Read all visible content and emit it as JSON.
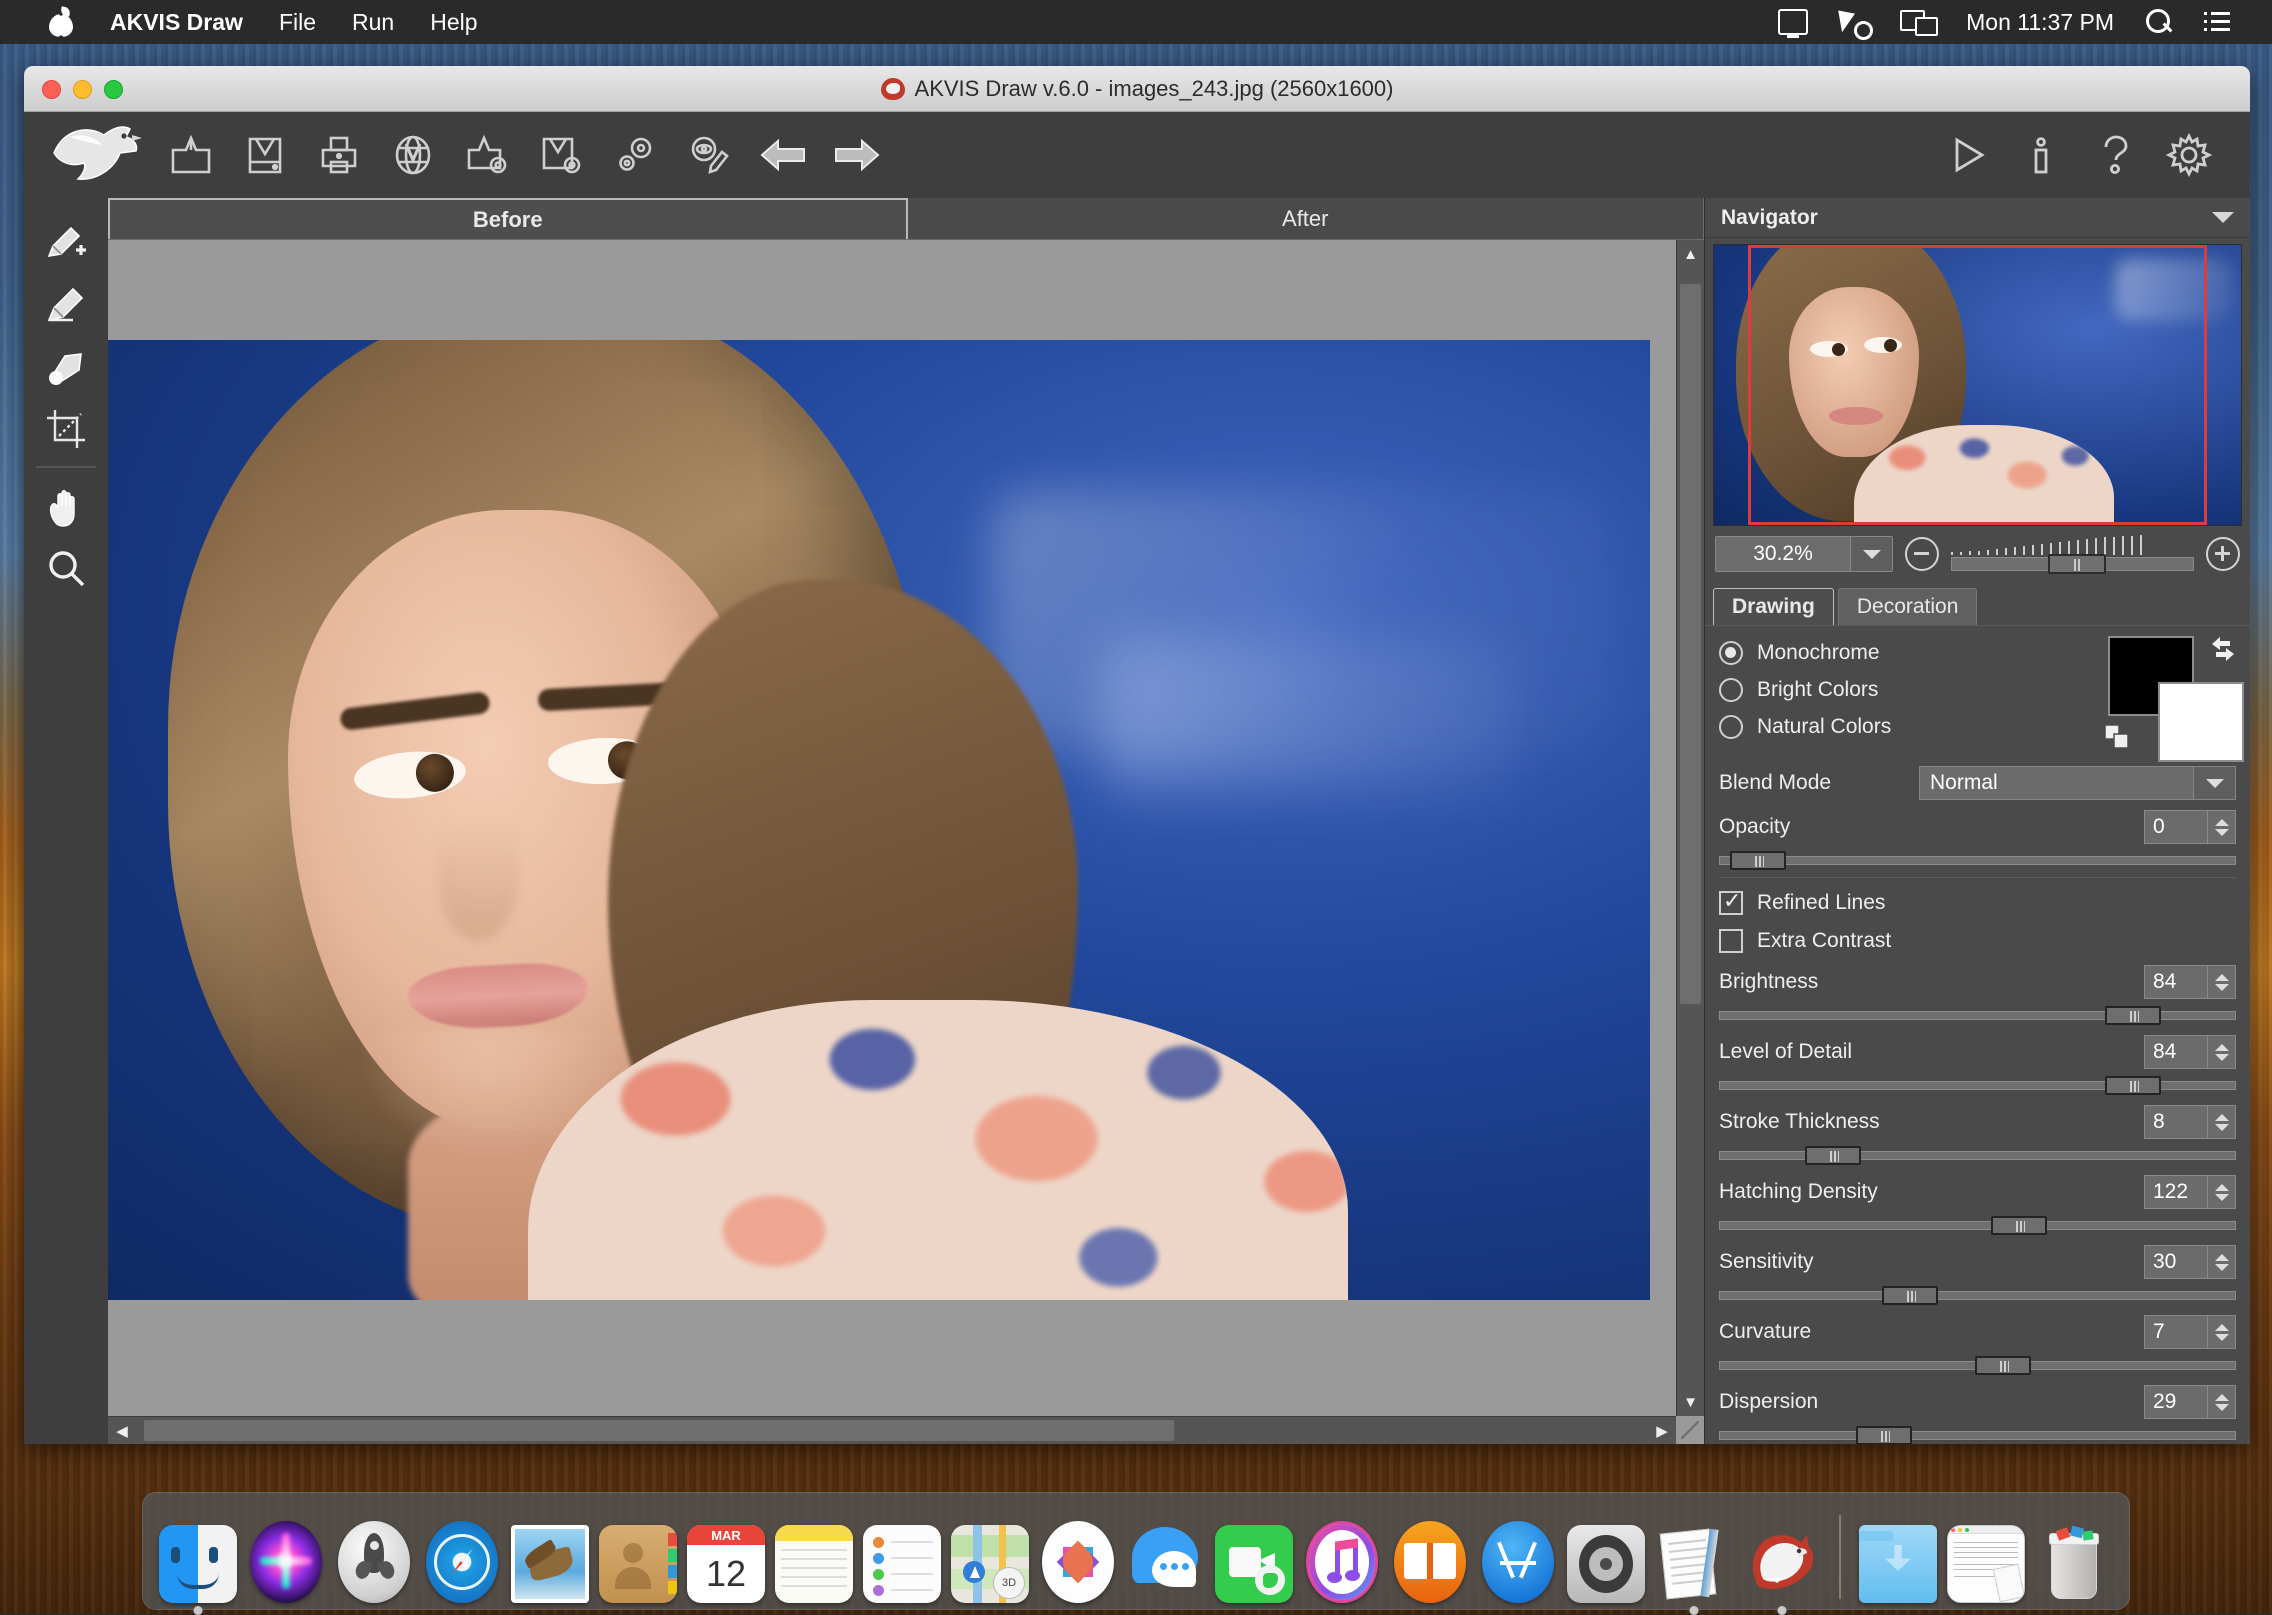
{
  "menubar": {
    "apple_icon": "apple-logo",
    "items": [
      "AKVIS Draw",
      "File",
      "Run",
      "Help"
    ],
    "status_icons": [
      "time-machine-icon",
      "siri-icon",
      "display-mirroring-icon"
    ],
    "clock": "Mon 11:37 PM",
    "search_icon": "search-icon",
    "notification_icon": "notification-center-icon"
  },
  "window": {
    "title": "AKVIS Draw v.6.0 - images_243.jpg (2560x1600)",
    "app_icon": "akvis-bird-icon",
    "traffic": [
      "close",
      "minimize",
      "zoom"
    ]
  },
  "toolbar": {
    "logo": "akvis-bird-logo",
    "buttons": [
      {
        "name": "open-image-button",
        "icon": "open-folder-icon"
      },
      {
        "name": "save-image-button",
        "icon": "save-disk-icon"
      },
      {
        "name": "print-image-button",
        "icon": "printer-icon"
      },
      {
        "name": "publish-web-button",
        "icon": "globe-icon"
      },
      {
        "name": "export-presets-button",
        "icon": "export-gear-icon"
      },
      {
        "name": "import-presets-button",
        "icon": "import-gear-icon"
      },
      {
        "name": "preferences-button",
        "icon": "gears-icon"
      },
      {
        "name": "batch-processing-button",
        "icon": "eye-pencil-icon"
      },
      {
        "name": "undo-button",
        "icon": "arrow-left-icon"
      },
      {
        "name": "redo-button",
        "icon": "arrow-right-icon"
      }
    ],
    "right_buttons": [
      {
        "name": "run-button",
        "icon": "play-icon"
      },
      {
        "name": "about-button",
        "icon": "info-icon"
      },
      {
        "name": "help-button",
        "icon": "question-icon"
      },
      {
        "name": "settings-button",
        "icon": "gear-icon"
      }
    ]
  },
  "tools": [
    {
      "name": "tool-pencil-add",
      "icon": "pencil-plus-icon"
    },
    {
      "name": "tool-pencil-erase",
      "icon": "pencil-icon"
    },
    {
      "name": "tool-eraser",
      "icon": "eraser-icon"
    },
    {
      "name": "tool-crop",
      "icon": "crop-icon"
    },
    {
      "name": "tool-hand",
      "icon": "hand-icon"
    },
    {
      "name": "tool-zoom",
      "icon": "magnifier-icon"
    }
  ],
  "image_tabs": [
    {
      "label": "Before",
      "active": true
    },
    {
      "label": "After",
      "active": false
    }
  ],
  "navigator": {
    "title": "Navigator",
    "collapse_icon": "chevron-down-icon",
    "zoom_value": "30.2%",
    "zoom_out_icon": "minus-circle-icon",
    "zoom_in_icon": "plus-circle-icon"
  },
  "settings": {
    "tabs": [
      {
        "label": "Drawing",
        "active": true
      },
      {
        "label": "Decoration",
        "active": false
      }
    ],
    "color_modes": [
      {
        "label": "Monochrome",
        "selected": true
      },
      {
        "label": "Bright Colors",
        "selected": false
      },
      {
        "label": "Natural Colors",
        "selected": false
      }
    ],
    "foreground_color": "#000000",
    "background_color": "#ffffff",
    "swap_icon": "swap-colors-icon",
    "reset_icon": "reset-colors-icon",
    "blend_mode": {
      "label": "Blend Mode",
      "value": "Normal"
    },
    "opacity": {
      "label": "Opacity",
      "value": "0",
      "pct": 4
    },
    "checkboxes": [
      {
        "label": "Refined Lines",
        "checked": true
      },
      {
        "label": "Extra Contrast",
        "checked": false
      }
    ],
    "sliders": [
      {
        "label": "Brightness",
        "value": "84",
        "pct": 80
      },
      {
        "label": "Level of Detail",
        "value": "84",
        "pct": 80
      },
      {
        "label": "Stroke Thickness",
        "value": "8",
        "pct": 22
      },
      {
        "label": "Hatching Density",
        "value": "122",
        "pct": 58
      },
      {
        "label": "Sensitivity",
        "value": "30",
        "pct": 37
      },
      {
        "label": "Curvature",
        "value": "7",
        "pct": 55
      },
      {
        "label": "Dispersion",
        "value": "29",
        "pct": 32
      }
    ]
  },
  "dock": {
    "items": [
      {
        "name": "dock-finder",
        "label": "Finder",
        "running": true
      },
      {
        "name": "dock-siri",
        "label": "Siri",
        "running": false
      },
      {
        "name": "dock-launchpad",
        "label": "Launchpad",
        "running": false
      },
      {
        "name": "dock-safari",
        "label": "Safari",
        "running": true
      },
      {
        "name": "dock-mail",
        "label": "Mail",
        "running": false
      },
      {
        "name": "dock-contacts",
        "label": "Contacts",
        "running": false
      },
      {
        "name": "dock-calendar",
        "label": "Calendar",
        "running": false,
        "month": "MAR",
        "day": "12"
      },
      {
        "name": "dock-notes",
        "label": "Notes",
        "running": false
      },
      {
        "name": "dock-reminders",
        "label": "Reminders",
        "running": false
      },
      {
        "name": "dock-maps",
        "label": "Maps",
        "running": false,
        "badge": "3D"
      },
      {
        "name": "dock-photos",
        "label": "Photos",
        "running": false
      },
      {
        "name": "dock-messages",
        "label": "Messages",
        "running": false
      },
      {
        "name": "dock-facetime",
        "label": "FaceTime",
        "running": false
      },
      {
        "name": "dock-itunes",
        "label": "iTunes",
        "running": false
      },
      {
        "name": "dock-ibooks",
        "label": "iBooks",
        "running": false
      },
      {
        "name": "dock-appstore",
        "label": "App Store",
        "running": false
      },
      {
        "name": "dock-system-preferences",
        "label": "System Preferences",
        "running": false
      },
      {
        "name": "dock-textedit",
        "label": "TextEdit",
        "running": true
      },
      {
        "name": "dock-akvis-draw",
        "label": "AKVIS Draw",
        "running": true
      }
    ],
    "right_items": [
      {
        "name": "dock-downloads",
        "label": "Downloads"
      },
      {
        "name": "dock-document",
        "label": "Document"
      },
      {
        "name": "dock-trash",
        "label": "Trash"
      }
    ]
  }
}
